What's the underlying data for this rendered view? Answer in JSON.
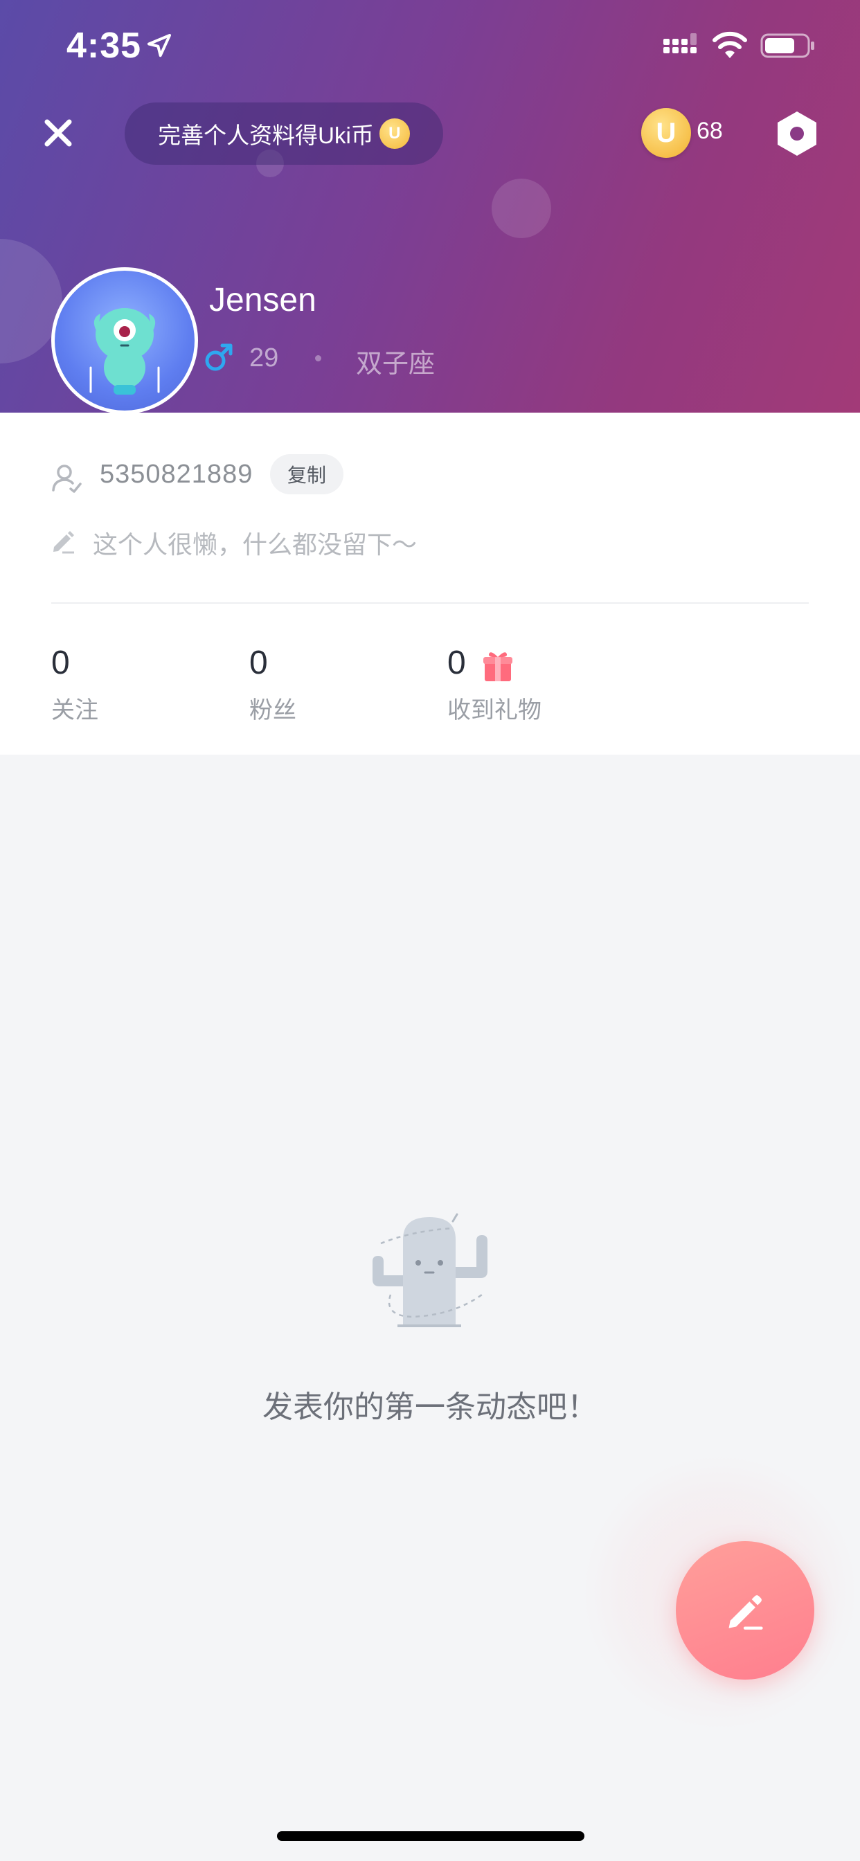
{
  "status_bar": {
    "time": "4:35"
  },
  "header": {
    "promo_text": "完善个人资料得Uki币",
    "coin_symbol": "U",
    "coin_balance": "68"
  },
  "profile": {
    "username": "Jensen",
    "age": "29",
    "zodiac": "双子座",
    "user_id": "5350821889",
    "copy_label": "复制",
    "bio_placeholder": "这个人很懒，什么都没留下～"
  },
  "stats": [
    {
      "value": "0",
      "label": "关注"
    },
    {
      "value": "0",
      "label": "粉丝"
    },
    {
      "value": "0",
      "label": "收到礼物"
    }
  ],
  "empty_state": {
    "message": "发表你的第一条动态吧！"
  },
  "colors": {
    "header_gradient_start": "#5b4ba8",
    "header_gradient_end": "#a23a78",
    "fab_color": "#ff8a92",
    "male_icon": "#2ea8f0",
    "coin": "#f5b93a"
  },
  "icons": [
    "location-arrow-icon",
    "signal-icon",
    "wifi-icon",
    "battery-icon",
    "close-icon",
    "coin-icon",
    "settings-icon",
    "male-icon",
    "user-id-icon",
    "pencil-icon",
    "gift-icon",
    "cactus-illustration",
    "compose-icon"
  ]
}
